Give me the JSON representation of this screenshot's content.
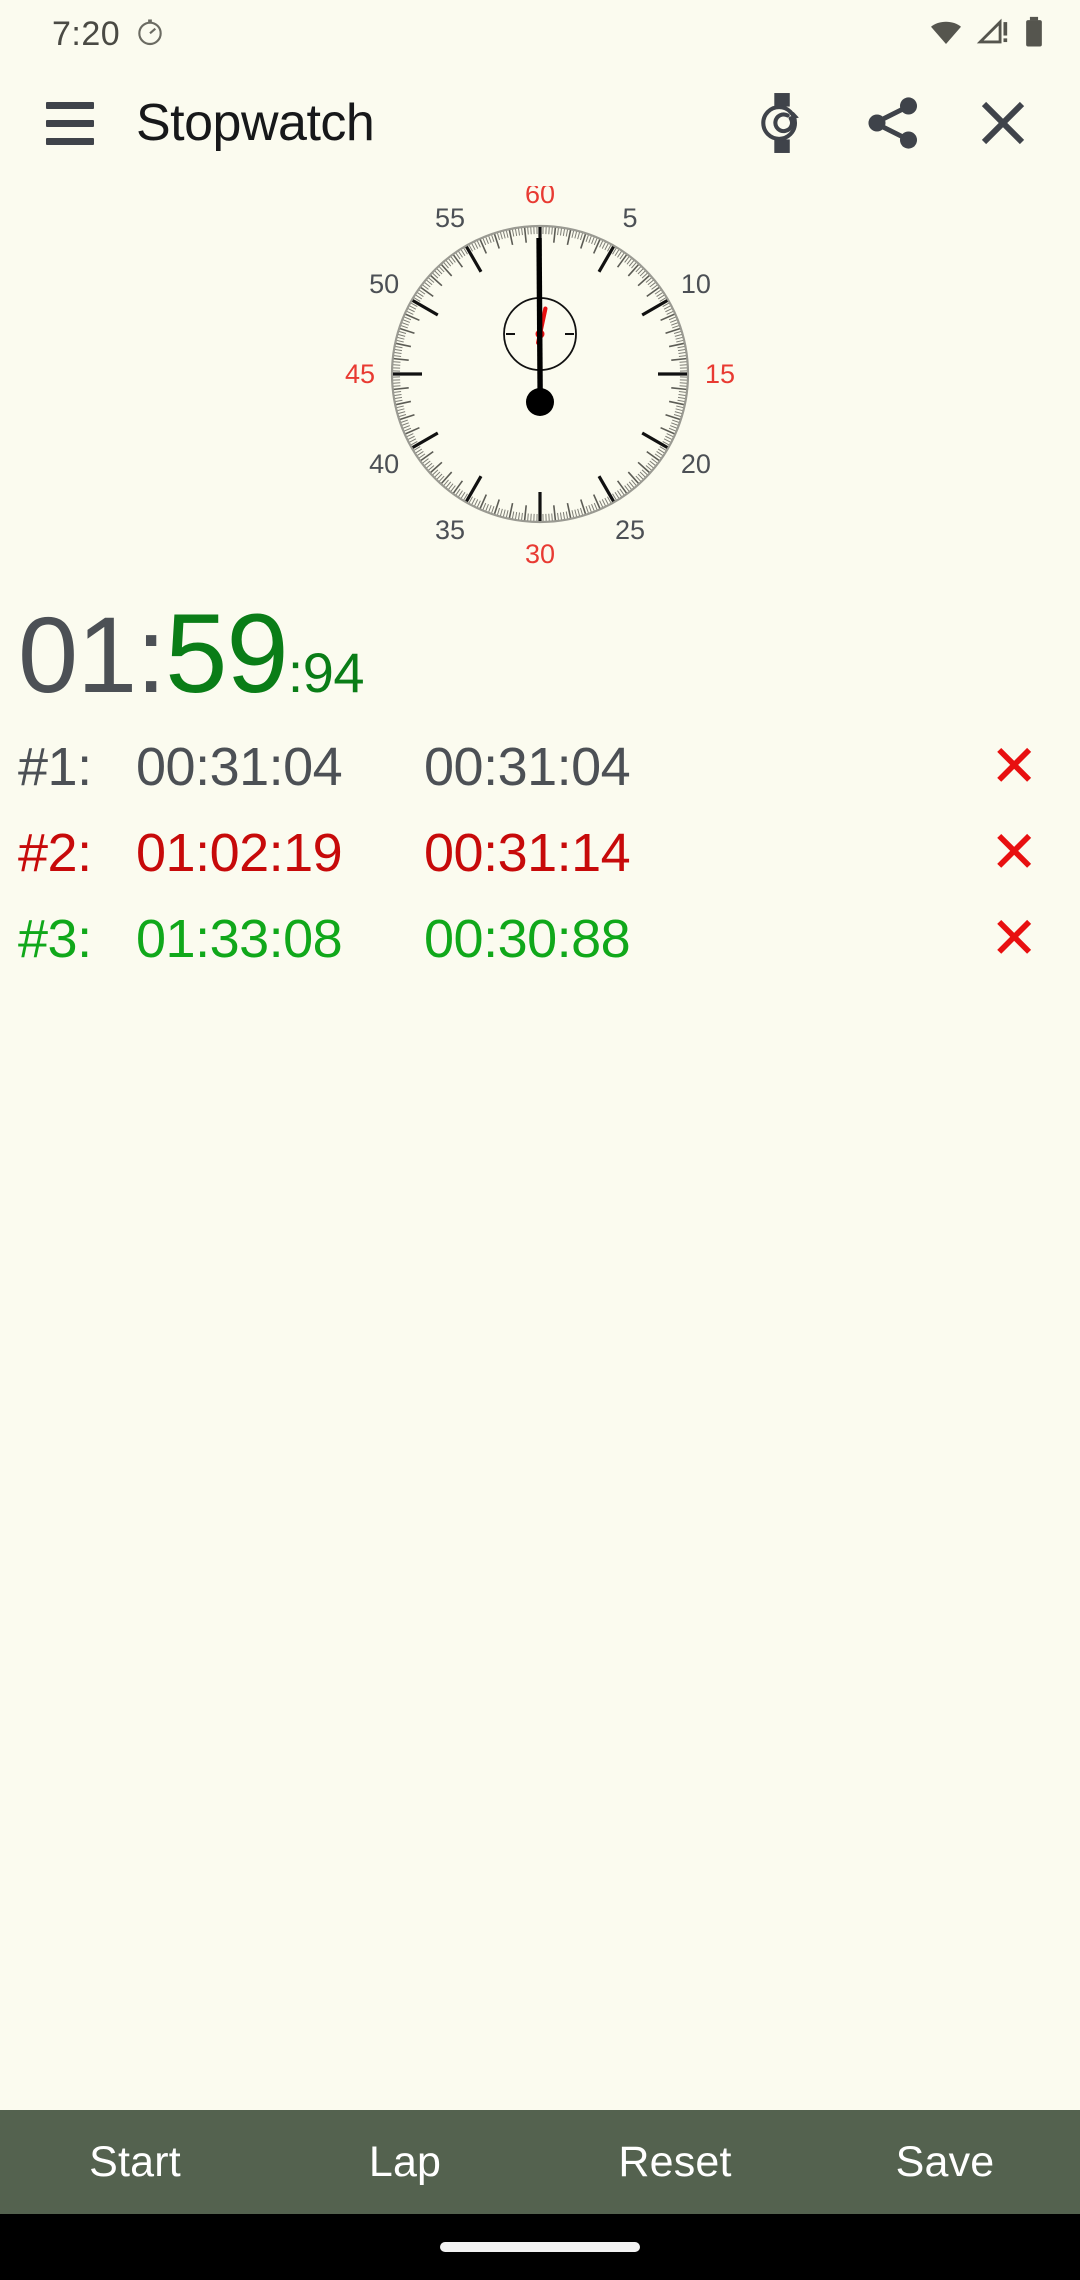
{
  "status_bar": {
    "time": "7:20",
    "stopwatch_icon": "stopwatch-icon",
    "wifi_icon": "wifi-icon",
    "signal_icon": "signal-alert-icon",
    "battery_icon": "battery-icon"
  },
  "app_bar": {
    "menu_icon": "hamburger-menu-icon",
    "title": "Stopwatch",
    "watch_icon": "send-to-watch-icon",
    "share_icon": "share-icon",
    "close_icon": "close-icon"
  },
  "dial": {
    "labels": [
      {
        "value": "60",
        "angle": 0,
        "color": "#e83a32"
      },
      {
        "value": "5",
        "angle": 30,
        "color": "#4c5055"
      },
      {
        "value": "10",
        "angle": 60,
        "color": "#4c5055"
      },
      {
        "value": "15",
        "angle": 90,
        "color": "#e83a32"
      },
      {
        "value": "20",
        "angle": 120,
        "color": "#4c5055"
      },
      {
        "value": "25",
        "angle": 150,
        "color": "#4c5055"
      },
      {
        "value": "30",
        "angle": 180,
        "color": "#e83a32"
      },
      {
        "value": "35",
        "angle": 210,
        "color": "#4c5055"
      },
      {
        "value": "40",
        "angle": 240,
        "color": "#4c5055"
      },
      {
        "value": "45",
        "angle": 270,
        "color": "#e83a32"
      },
      {
        "value": "50",
        "angle": 300,
        "color": "#4c5055"
      },
      {
        "value": "55",
        "angle": 330,
        "color": "#4c5055"
      }
    ],
    "second_hand_angle": 359.6,
    "minute_hand_angle": 12,
    "rim_color": "#9a9a92",
    "hand_color": "#000000",
    "minute_hand_color": "#e81010"
  },
  "display": {
    "minutes": "01:",
    "seconds": "59",
    "fraction": ":94",
    "minutes_color": "#4c5055",
    "seconds_color": "#0a7d17"
  },
  "laps": {
    "rows": [
      {
        "index": "#1:",
        "total": "00:31:04",
        "split": "00:31:04",
        "color": "#4c5055",
        "delete": "✕"
      },
      {
        "index": "#2:",
        "total": "01:02:19",
        "split": "00:31:14",
        "color": "#c70a0a",
        "delete": "✕"
      },
      {
        "index": "#3:",
        "total": "01:33:08",
        "split": "00:30:88",
        "color": "#10a81a",
        "delete": "✕"
      }
    ]
  },
  "buttons": {
    "start": "Start",
    "lap": "Lap",
    "reset": "Reset",
    "save": "Save",
    "bar_color": "#54624f"
  },
  "nav": {
    "home_pill": "home-indicator"
  }
}
